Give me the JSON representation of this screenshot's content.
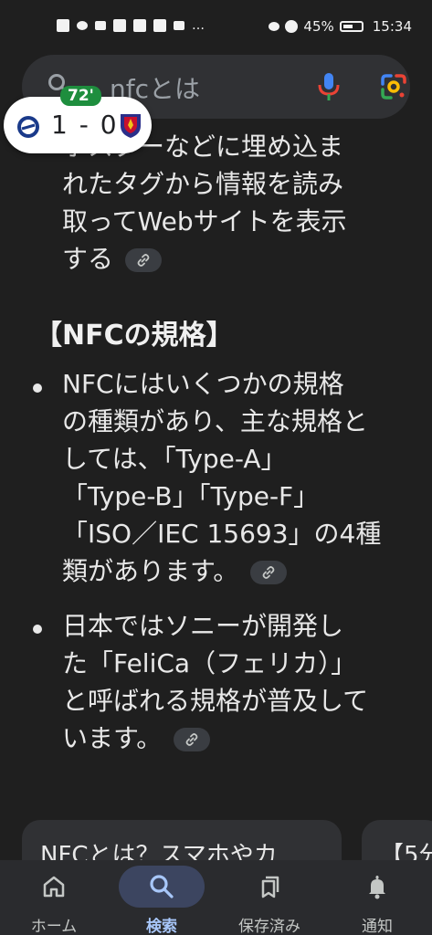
{
  "status_bar": {
    "battery": "45%",
    "time": "15:34"
  },
  "search": {
    "query": "nfcとは"
  },
  "score": {
    "minute": "72'",
    "result": "1 - 0"
  },
  "intro_paragraph": {
    "lines": [
      "ポスターなどに埋め込ま",
      "れたタグから情報を読み",
      "取ってWebサイトを表示",
      "する"
    ]
  },
  "section_heading": "【NFCの規格】",
  "bullets": [
    {
      "lines": [
        "NFCにはいくつかの規格",
        "の種類があり、主な規格と",
        "しては、「Type-A」",
        "「Type-B」「Type-F」",
        "「ISO／IEC 15693」の4種",
        "類があります。"
      ]
    },
    {
      "lines": [
        "日本ではソニーが開発し",
        "た「FeliCa（フェリカ）」",
        "と呼ばれる規格が普及して",
        "います。"
      ]
    }
  ],
  "cards": [
    {
      "title": "NFCとは？スマホやカ"
    },
    {
      "title": "【5分"
    }
  ],
  "bottom_nav": {
    "items": [
      {
        "label": "ホーム",
        "icon": "home-icon",
        "active": false
      },
      {
        "label": "検索",
        "icon": "search-icon",
        "active": true
      },
      {
        "label": "保存済み",
        "icon": "bookmarks-icon",
        "active": false
      },
      {
        "label": "通知",
        "icon": "bell-icon",
        "active": false
      }
    ]
  },
  "colors": {
    "background": "#1f1f1f",
    "accent": "#a8c7fa",
    "score_minute": "#1e8e3e"
  }
}
